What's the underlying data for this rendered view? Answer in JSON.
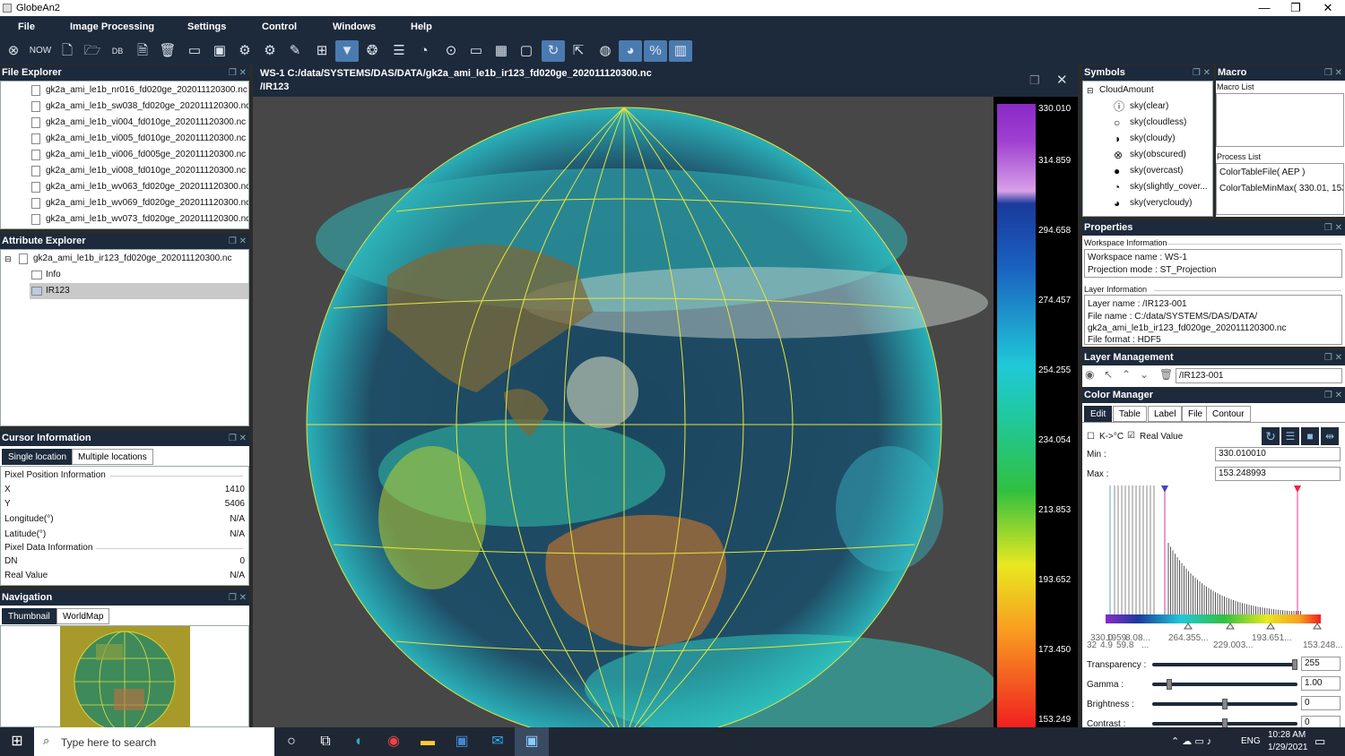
{
  "window": {
    "title": "GlobeAn2",
    "minimize": "—",
    "maximize": "❐",
    "close": "✕"
  },
  "menu": [
    "File",
    "Image Processing",
    "Settings",
    "Control",
    "Windows",
    "Help"
  ],
  "toolbar": {
    "now_label": "NOW",
    "db_label": "DB"
  },
  "file_explorer": {
    "title": "File Explorer",
    "files": [
      "gk2a_ami_le1b_nr016_fd020ge_202011120300.nc",
      "gk2a_ami_le1b_sw038_fd020ge_202011120300.nc",
      "gk2a_ami_le1b_vi004_fd010ge_202011120300.nc",
      "gk2a_ami_le1b_vi005_fd010ge_202011120300.nc",
      "gk2a_ami_le1b_vi006_fd005ge_202011120300.nc",
      "gk2a_ami_le1b_vi008_fd010ge_202011120300.nc",
      "gk2a_ami_le1b_wv063_fd020ge_202011120300.nc",
      "gk2a_ami_le1b_wv069_fd020ge_202011120300.nc",
      "gk2a_ami_le1b_wv073_fd020ge_202011120300.nc"
    ]
  },
  "attribute_explorer": {
    "title": "Attribute Explorer",
    "root": "gk2a_ami_le1b_ir123_fd020ge_202011120300.nc",
    "children": [
      "Info",
      "IR123"
    ]
  },
  "cursor_info": {
    "title": "Cursor Information",
    "tabs": [
      "Single location",
      "Multiple locations"
    ],
    "pixel_header": "Pixel Position Information",
    "x_label": "X",
    "x_value": "1410",
    "y_label": "Y",
    "y_value": "5406",
    "lon_label": "Longitude(°)",
    "lon_value": "N/A",
    "lat_label": "Latitude(°)",
    "lat_value": "N/A",
    "data_header": "Pixel Data Information",
    "dn_label": "DN",
    "dn_value": "0",
    "real_label": "Real Value",
    "real_value": "N/A"
  },
  "navigation": {
    "title": "Navigation",
    "tabs": [
      "Thumbnail",
      "WorldMap"
    ]
  },
  "workspace": {
    "title": "WS-1 C:/data/SYSTEMS/DAS/DATA/gk2a_ami_le1b_ir123_fd020ge_202011120300.nc",
    "subtitle": "/IR123",
    "colorbar_labels": [
      "330.010",
      "314.859",
      "294.658",
      "274.457",
      "254.255",
      "234.054",
      "213.853",
      "193.652",
      "173.450",
      "153.249"
    ]
  },
  "symbols": {
    "title": "Symbols",
    "group": "CloudAmount",
    "items": [
      {
        "label": "sky(clear)",
        "icon": "sky-clear-icon"
      },
      {
        "label": "sky(cloudless)",
        "icon": "sky-cloudless-icon"
      },
      {
        "label": "sky(cloudy)",
        "icon": "sky-cloudy-icon"
      },
      {
        "label": "sky(obscured)",
        "icon": "sky-obscured-icon"
      },
      {
        "label": "sky(overcast)",
        "icon": "sky-overcast-icon"
      },
      {
        "label": "sky(slightly_cover...",
        "icon": "sky-slightly-covered-icon"
      },
      {
        "label": "sky(verycloudy)",
        "icon": "sky-verycloudy-icon"
      }
    ]
  },
  "macro": {
    "title": "Macro",
    "macro_list_label": "Macro List",
    "process_list_label": "Process List",
    "process_items": [
      "ColorTableFile( AEP )",
      "ColorTableMinMax( 330.01, 153"
    ]
  },
  "properties": {
    "title": "Properties",
    "workspace_info_label": "Workspace Information",
    "workspace_name": "Workspace name : WS-1",
    "projection": "Projection mode : ST_Projection",
    "layer_info_label": "Layer Information",
    "layer_name": "Layer name : /IR123-001",
    "file_name_1": "File name : C:/data/SYSTEMS/DAS/DATA/",
    "file_name_2": "gk2a_ami_le1b_ir123_fd020ge_202011120300.nc",
    "file_format": "File format : HDF5"
  },
  "layer_mgmt": {
    "title": "Layer Management",
    "layer": "/IR123-001"
  },
  "color_manager": {
    "title": "Color Manager",
    "tabs": [
      "Edit",
      "Table",
      "Label",
      "File",
      "Contour"
    ],
    "k_to_c": "K->°C",
    "real_value": "Real Value",
    "min_label": "Min :",
    "min_value": "330.010010",
    "max_label": "Max :",
    "max_value": "153.248993",
    "hist_labels_top": [
      "330.0",
      "1959.",
      "8.0",
      "8...",
      "264.355...",
      "193.651..."
    ],
    "hist_labels_bottom": [
      "32",
      "4.9",
      "59.8",
      "...",
      "229.003...",
      "153.248..."
    ],
    "transparency_label": "Transparency :",
    "transparency_value": "255",
    "transparency": 1.0,
    "gamma_label": "Gamma :",
    "gamma_value": "1.00",
    "gamma": 0.1,
    "brightness_label": "Brightness :",
    "brightness_value": "0",
    "brightness": 0.5,
    "contrast_label": "Contrast :",
    "contrast_value": "0",
    "contrast": 0.5
  },
  "taskbar": {
    "search_placeholder": "Type here to search",
    "lang": "ENG",
    "time": "10:28 AM",
    "date": "1/29/2021"
  }
}
